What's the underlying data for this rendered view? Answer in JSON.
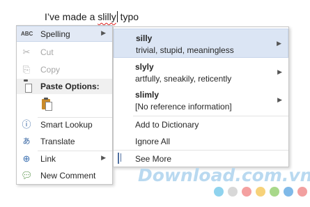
{
  "document": {
    "text_before": "I’ve made a ",
    "misspelled_word": "slilly",
    "text_after": " typo"
  },
  "context_menu": {
    "spelling": "Spelling",
    "spelling_icon": "ABC",
    "cut": "Cut",
    "copy": "Copy",
    "paste_options": "Paste Options:",
    "smart_lookup": "Smart Lookup",
    "translate": "Translate",
    "link": "Link",
    "new_comment": "New Comment"
  },
  "spelling_menu": {
    "suggestions": [
      {
        "word": "silly",
        "definition": "trivial, stupid, meaningless"
      },
      {
        "word": "slyly",
        "definition": "artfully, sneakily, reticently"
      },
      {
        "word": "slimly",
        "definition": "[No reference information]"
      }
    ],
    "add_to_dictionary": "Add to Dictionary",
    "ignore_all": "Ignore All",
    "see_more": "See More"
  },
  "watermark": {
    "text": "Download.com.vn",
    "dot_colors": [
      "#8fd3ee",
      "#d8d8d8",
      "#f4a0a0",
      "#f7d27a",
      "#a8d88a",
      "#7fb9e8",
      "#f2a0a0"
    ]
  },
  "colors": {
    "highlight": "#dbe5f4",
    "disabled_text": "#a6a6a6",
    "spell_underline": "#e02020"
  }
}
